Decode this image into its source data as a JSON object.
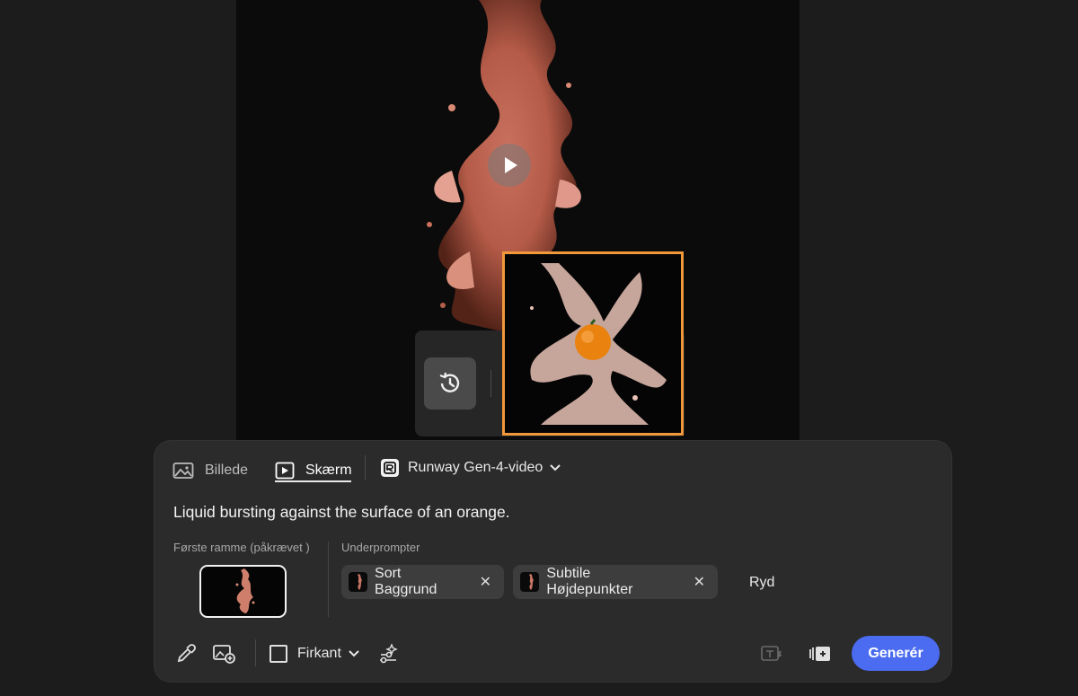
{
  "preview": {
    "play_icon": "play-icon",
    "history_icon": "history-icon"
  },
  "tabs": [
    {
      "label": "Billede",
      "icon": "image-icon",
      "active": false
    },
    {
      "label": "Skærm",
      "icon": "video-icon",
      "active": true
    }
  ],
  "model": {
    "label": "Runway Gen-4-video",
    "icon": "runway-logo-icon"
  },
  "prompt": {
    "text": "Liquid bursting against the surface of an orange."
  },
  "first_frame": {
    "label": "Første ramme (påkrævet )"
  },
  "subprompts": {
    "label": "Underprompter",
    "chips": [
      {
        "label": "Sort Baggrund"
      },
      {
        "label": "Subtile Højdepunkter"
      }
    ],
    "clear_label": "Ryd"
  },
  "toolbar": {
    "aspect_label": "Firkant",
    "generate_label": "Generér",
    "icons": [
      "eyedropper-icon",
      "add-image-icon",
      "effects-icon",
      "text-to-video-icon",
      "frames-icon"
    ]
  },
  "colors": {
    "accent": "#4b6cf0",
    "selection": "#f0983a",
    "panel": "#2b2b2b",
    "background": "#1c1c1c"
  }
}
